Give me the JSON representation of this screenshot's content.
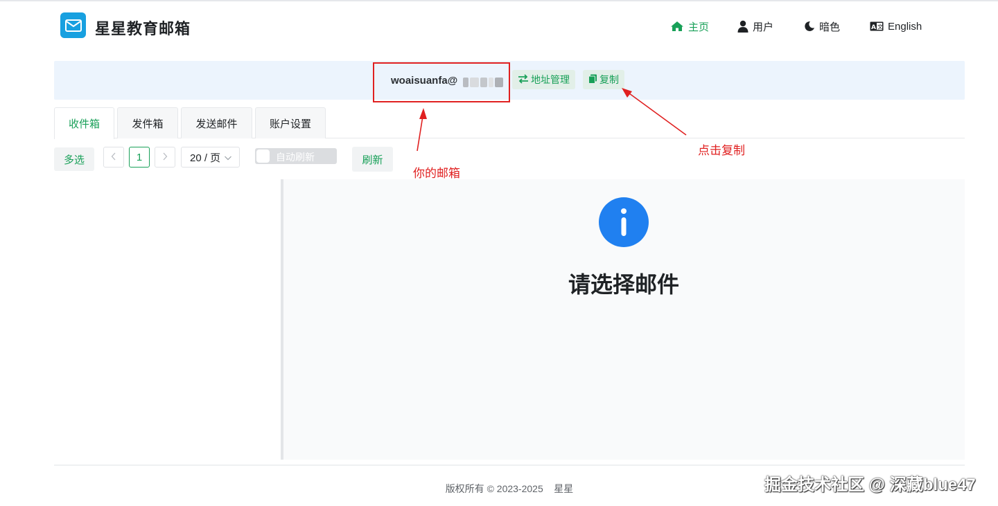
{
  "header": {
    "app_title": "星星教育邮箱",
    "nav": {
      "home": "主页",
      "user": "用户",
      "dark": "暗色",
      "language": "English"
    }
  },
  "address": {
    "email_prefix": "woaisuanfa@",
    "manage_label": "地址管理",
    "copy_label": "复制"
  },
  "tabs": [
    {
      "label": "收件箱",
      "active": true
    },
    {
      "label": "发件箱",
      "active": false
    },
    {
      "label": "发送邮件",
      "active": false
    },
    {
      "label": "账户设置",
      "active": false
    }
  ],
  "toolbar": {
    "multi_select": "多选",
    "current_page": "1",
    "page_size": "20 / 页",
    "auto_refresh_label": "自动刷新",
    "auto_refresh_on": false,
    "refresh": "刷新"
  },
  "detail": {
    "empty_message": "请选择邮件"
  },
  "footer": {
    "copyright": "版权所有 © 2023-2025    星星"
  },
  "annotations": {
    "your_mailbox": "你的邮箱",
    "click_copy": "点击复制"
  },
  "watermark": "掘金技术社区 @ 深藏blue47",
  "colors": {
    "accent": "#18a058",
    "info": "#2080f0",
    "annotation": "#e02020",
    "logo": "#18a0e0"
  }
}
